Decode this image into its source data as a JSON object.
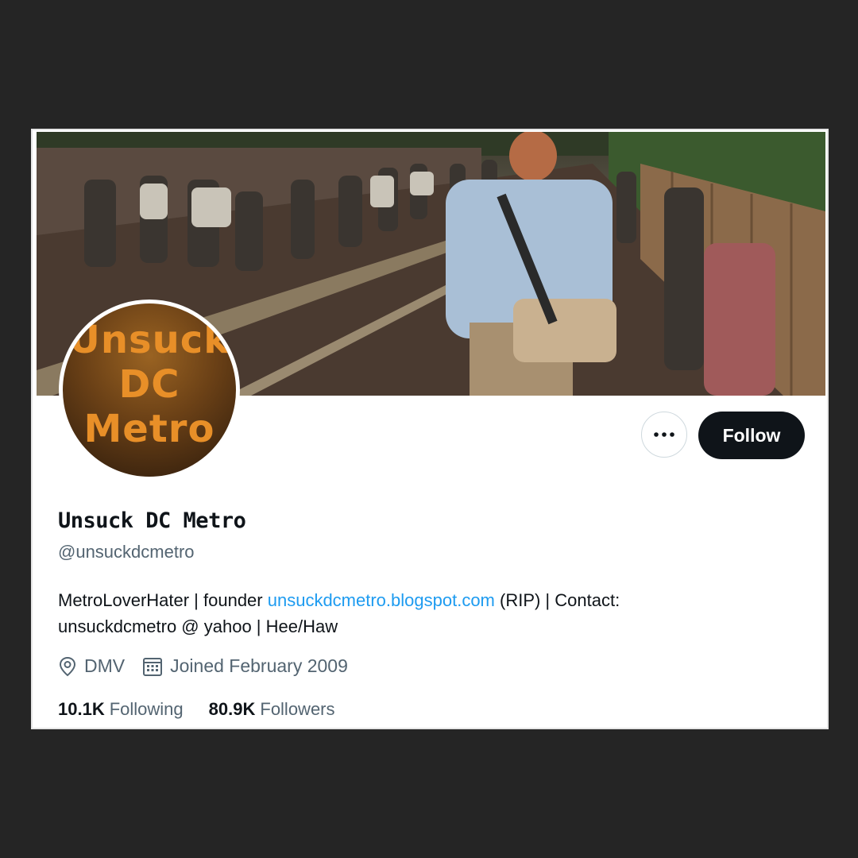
{
  "profile": {
    "avatar_text": [
      "Unsuck",
      "DC",
      "Metro"
    ],
    "display_name": "Unsuck DC Metro",
    "handle": "@unsuckdcmetro",
    "bio": {
      "prefix": "MetroLoverHater | founder ",
      "link": "unsuckdcmetro.blogspot.com",
      "suffix": " (RIP) | Contact:",
      "line2": "unsuckdcmetro @ yahoo | Hee/Haw"
    },
    "location": "DMV",
    "joined": "Joined February 2009",
    "following_count": "10.1K",
    "following_label": "Following",
    "followers_count": "80.9K",
    "followers_label": "Followers"
  },
  "actions": {
    "follow_label": "Follow",
    "more_icon": "more-horizontal-icon"
  },
  "icons": {
    "location": "location-pin-icon",
    "calendar": "calendar-icon"
  },
  "colors": {
    "page_background": "#252525",
    "follow_button": "#0f1419",
    "link": "#1d9bf0",
    "secondary_text": "#536471",
    "avatar_text": "#e88f28"
  }
}
